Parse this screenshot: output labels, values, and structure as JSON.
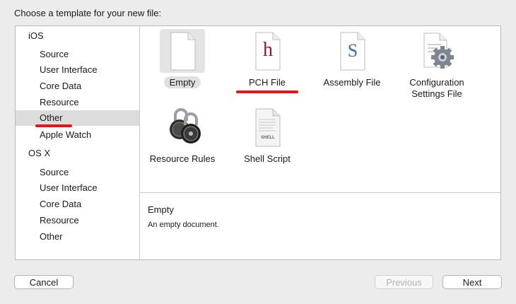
{
  "dialog": {
    "title": "Choose a template for your new file:"
  },
  "sidebar": {
    "groups": [
      {
        "label": "iOS",
        "items": [
          "Source",
          "User Interface",
          "Core Data",
          "Resource",
          "Other",
          "Apple Watch"
        ]
      },
      {
        "label": "OS X",
        "items": [
          "Source",
          "User Interface",
          "Core Data",
          "Resource",
          "Other"
        ]
      }
    ],
    "selected": "Other",
    "annotation_color": "#e8141a"
  },
  "templates": [
    {
      "label": "Empty",
      "icon": "blank-document-icon",
      "selected": true
    },
    {
      "label": "PCH File",
      "icon": "h-document-icon",
      "glyph": "h",
      "glyph_color": "#8b1d2c"
    },
    {
      "label": "Assembly File",
      "icon": "s-document-icon",
      "glyph": "S",
      "glyph_color": "#3a6ea5"
    },
    {
      "label": "Configuration Settings File",
      "icon": "gear-document-icon"
    },
    {
      "label": "Resource Rules",
      "icon": "padlocks-icon"
    },
    {
      "label": "Shell Script",
      "icon": "shell-document-icon",
      "glyph": "SHELL"
    }
  ],
  "description": {
    "title": "Empty",
    "text": "An empty document."
  },
  "buttons": {
    "cancel": "Cancel",
    "previous": "Previous",
    "next": "Next"
  }
}
